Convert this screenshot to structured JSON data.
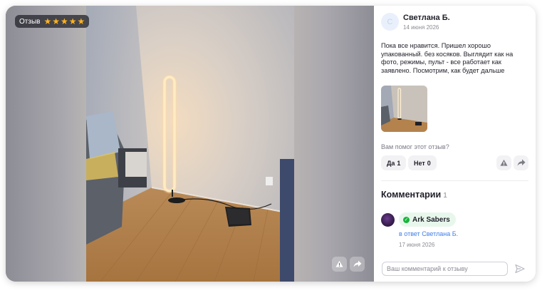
{
  "media": {
    "rating_label": "Отзыв",
    "rating_stars": 5,
    "report_icon": "report-icon",
    "share_icon": "share-icon"
  },
  "review": {
    "author": "Светлана Б.",
    "date": "14 июня 2026",
    "text": "Пока все нравится. Пришел хорошо упакованный. без косяков. Выглядит как на фото, режимы, пульт - все работает как заявлено. Посмотрим, как будет дальше",
    "helpful_question": "Вам помог этот отзыв?",
    "yes_label": "Да",
    "yes_count": "1",
    "no_label": "Нет",
    "no_count": "0"
  },
  "comments": {
    "title": "Комментарии",
    "count": "1",
    "items": [
      {
        "author": "Ark Sabers",
        "reply_to": "в ответ Светлана Б.",
        "date": "17 июня 2026"
      }
    ],
    "input_placeholder": "Ваш комментарий к отзыву"
  },
  "colors": {
    "star": "#ffb320",
    "link": "#3f7ee8",
    "verified": "#19b33c"
  }
}
